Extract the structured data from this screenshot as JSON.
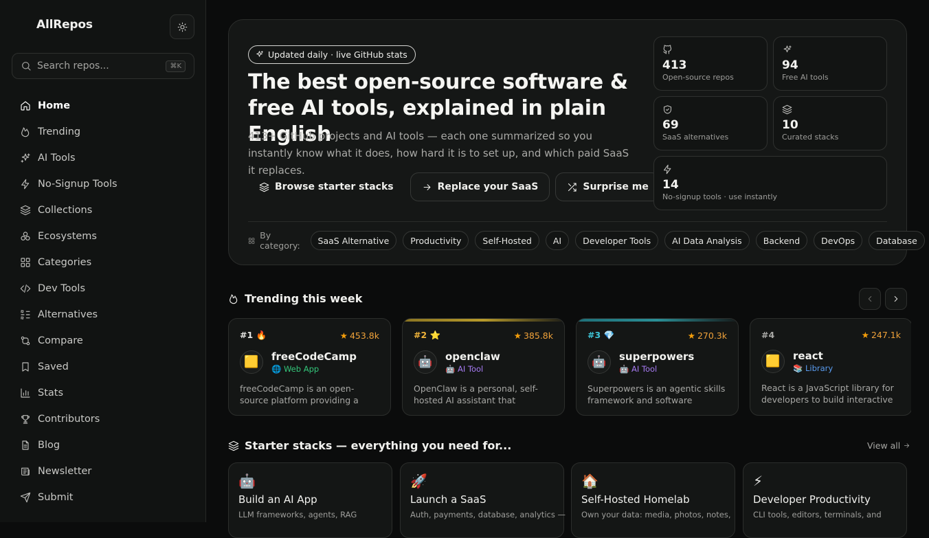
{
  "brand": "AllRepos",
  "search": {
    "placeholder": "Search repos...",
    "shortcut": "⌘K"
  },
  "nav": [
    {
      "label": "Home",
      "icon": "home-icon",
      "active": true
    },
    {
      "label": "Trending",
      "icon": "flame-icon"
    },
    {
      "label": "AI Tools",
      "icon": "sparkles-icon"
    },
    {
      "label": "No-Signup Tools",
      "icon": "zap-icon"
    },
    {
      "label": "Collections",
      "icon": "layers-icon"
    },
    {
      "label": "Ecosystems",
      "icon": "circles-icon"
    },
    {
      "label": "Categories",
      "icon": "grid-icon"
    },
    {
      "label": "Dev Tools",
      "icon": "code-icon"
    },
    {
      "label": "Alternatives",
      "icon": "shuffle-icon"
    },
    {
      "label": "Compare",
      "icon": "git-compare-icon"
    },
    {
      "label": "Saved",
      "icon": "bookmark-icon"
    },
    {
      "label": "Stats",
      "icon": "bar-chart-icon"
    },
    {
      "label": "Contributors",
      "icon": "trophy-icon"
    },
    {
      "label": "Blog",
      "icon": "file-icon"
    },
    {
      "label": "Newsletter",
      "icon": "newspaper-icon"
    },
    {
      "label": "Submit",
      "icon": "send-icon"
    }
  ],
  "hero": {
    "pill": "Updated daily · live GitHub stats",
    "title": "The best open-source software & free AI tools, explained in plain English",
    "subtitle": "413+ GitHub projects and AI tools — each one summarized so you instantly know what it does, how hard it is to set up, and which paid SaaS it replaces.",
    "buttons": {
      "browse": "Browse starter stacks",
      "replace": "Replace your SaaS",
      "surprise": "Surprise me"
    },
    "stats": [
      {
        "value": "413",
        "label": "Open-source repos",
        "icon": "github-icon"
      },
      {
        "value": "94",
        "label": "Free AI tools",
        "icon": "sparkles-icon"
      },
      {
        "value": "69",
        "label": "SaaS alternatives",
        "icon": "shield-icon"
      },
      {
        "value": "10",
        "label": "Curated stacks",
        "icon": "layers-icon"
      },
      {
        "value": "14",
        "label": "No-signup tools · use instantly",
        "icon": "zap-icon"
      }
    ],
    "categories_label": "By category:",
    "categories": [
      "SaaS Alternative",
      "Productivity",
      "Self-Hosted",
      "AI",
      "Developer Tools",
      "AI Data Analysis",
      "Backend",
      "DevOps",
      "Database"
    ]
  },
  "trending": {
    "title": "Trending this week",
    "cards": [
      {
        "rank": "#1",
        "badge": "🔥",
        "stars": "453.8k",
        "avatar": "🟨",
        "name": "freeCodeCamp",
        "type": "🌐 Web App",
        "type_color": "#34c77b",
        "desc": "freeCodeCamp is an open-source platform providing a free, self-paced curriculum",
        "rank_color": "#e4e4e1",
        "bar": ""
      },
      {
        "rank": "#2",
        "badge": "⭐",
        "stars": "385.8k",
        "avatar": "🤖",
        "name": "openclaw",
        "type": "🤖 AI Tool",
        "type_color": "#a77bf3",
        "desc": "OpenClaw is a personal, self-hosted AI assistant that integrates with your tools",
        "rank_color": "#f0b43a",
        "bar": "linear-gradient(90deg,#8a7422,#b79a2a 50%,#1e1e18)"
      },
      {
        "rank": "#3",
        "badge": "💎",
        "stars": "270.3k",
        "avatar": "🤖",
        "name": "superpowers",
        "type": "🤖 AI Tool",
        "type_color": "#a77bf3",
        "desc": "Superpowers is an agentic skills framework and software development methodology",
        "rank_color": "#3ec6d8",
        "bar": "linear-gradient(90deg,#1f6f78,#2a8f96 50%,#161a1a)"
      },
      {
        "rank": "#4",
        "badge": "",
        "stars": "247.1k",
        "avatar": "🟨",
        "name": "react",
        "type": "📚 Library",
        "type_color": "#5a9cf0",
        "desc": "React is a JavaScript library for developers to build interactive user interfaces",
        "rank_color": "#a9a9a6",
        "bar": ""
      }
    ]
  },
  "stacks": {
    "title": "Starter stacks — everything you need for...",
    "view_all": "View all",
    "cards": [
      {
        "emoji": "🤖",
        "title": "Build an AI App",
        "desc": "LLM frameworks, agents, RAG"
      },
      {
        "emoji": "🚀",
        "title": "Launch a SaaS",
        "desc": "Auth, payments, database, analytics —"
      },
      {
        "emoji": "🏠",
        "title": "Self-Hosted Homelab",
        "desc": "Own your data: media, photos, notes,"
      },
      {
        "emoji": "⚡",
        "title": "Developer Productivity",
        "desc": "CLI tools, editors, terminals, and"
      }
    ]
  }
}
